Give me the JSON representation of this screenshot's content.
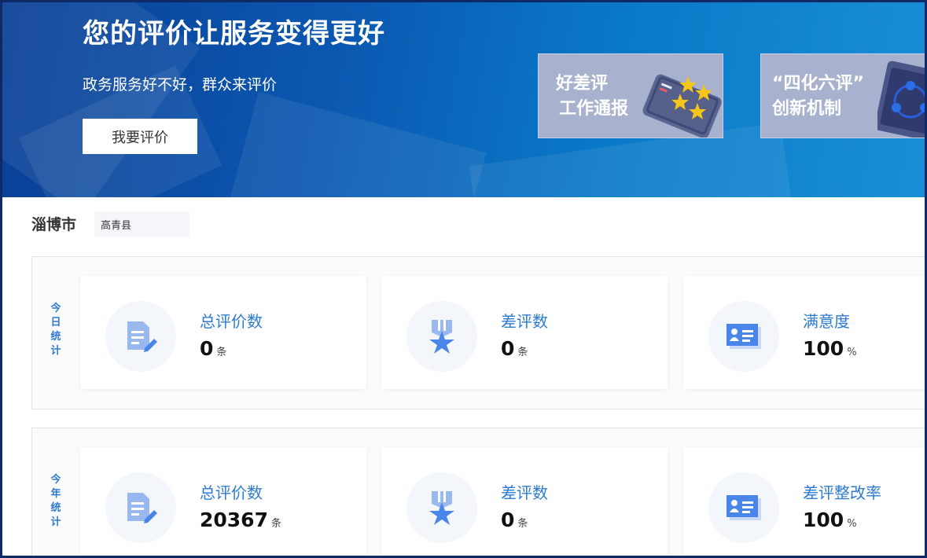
{
  "banner": {
    "title": "您的评价让服务变得更好",
    "subtitle": "政务服务好不好，群众来评价",
    "rate_button": "我要评价",
    "promos": [
      {
        "line1": "好差评",
        "line2": "工作通报"
      },
      {
        "line1": "“四化六评”",
        "line2": "创新机制"
      }
    ]
  },
  "location": {
    "city": "淄博市",
    "county": "高青县"
  },
  "today": {
    "label": "今日统计",
    "label_chars": [
      "今",
      "日",
      "统",
      "计"
    ],
    "cards": [
      {
        "icon": "document-edit-icon",
        "label": "总评价数",
        "value": "0",
        "unit": "条"
      },
      {
        "icon": "ribbon-star-icon",
        "label": "差评数",
        "value": "0",
        "unit": "条"
      },
      {
        "icon": "id-card-icon",
        "label": "满意度",
        "value": "100",
        "unit": "%"
      }
    ]
  },
  "year": {
    "label": "今年统计",
    "label_chars": [
      "今",
      "年",
      "统",
      "计"
    ],
    "cards": [
      {
        "icon": "document-edit-icon",
        "label": "总评价数",
        "value": "20367",
        "unit": "条"
      },
      {
        "icon": "ribbon-star-icon",
        "label": "差评数",
        "value": "0",
        "unit": "条"
      },
      {
        "icon": "id-card-icon",
        "label": "差评整改率",
        "value": "100",
        "unit": "%"
      }
    ]
  },
  "colors": {
    "banner_dark": "#0a3f95",
    "banner_light": "#1a8fd6",
    "accent_blue": "#2d7bd0",
    "icon_blue": "#4a86e8",
    "promo_bg": "#a8b2cf"
  }
}
